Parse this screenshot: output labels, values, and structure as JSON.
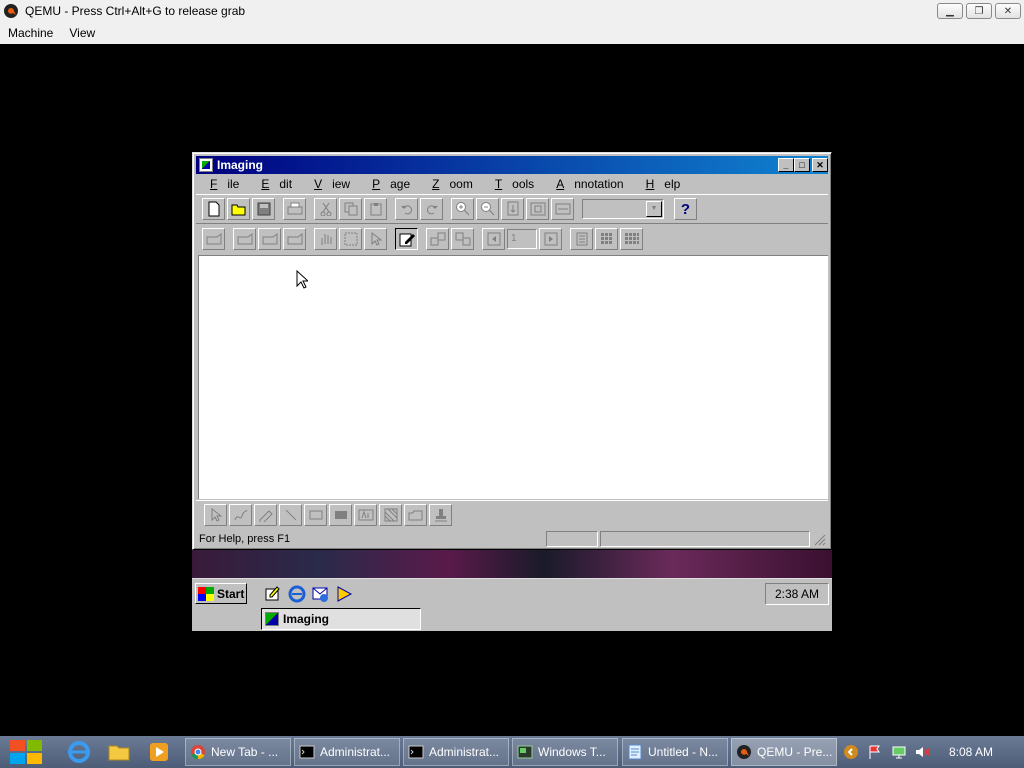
{
  "host": {
    "title": "QEMU - Press Ctrl+Alt+G to release grab",
    "menu": [
      "Machine",
      "View"
    ],
    "controls": {
      "minimize": "▁",
      "restore": "❐",
      "close": "✕"
    }
  },
  "imaging": {
    "title": "Imaging",
    "menu": [
      {
        "label": "File",
        "key": "F",
        "rest": "ile"
      },
      {
        "label": "Edit",
        "key": "E",
        "rest": "dit"
      },
      {
        "label": "View",
        "key": "V",
        "rest": "iew"
      },
      {
        "label": "Page",
        "key": "P",
        "rest": "age"
      },
      {
        "label": "Zoom",
        "key": "Z",
        "rest": "oom"
      },
      {
        "label": "Tools",
        "key": "T",
        "rest": "ools"
      },
      {
        "label": "Annotation",
        "key": "A",
        "rest": "nnotation"
      },
      {
        "label": "Help",
        "key": "H",
        "rest": "elp"
      }
    ],
    "help_button": "?",
    "page_number": "1",
    "status_text": "For Help, press F1",
    "window_buttons": {
      "minimize": "_",
      "maximize": "□",
      "close": "✕"
    }
  },
  "guest_taskbar": {
    "start_label": "Start",
    "clock": "2:38 AM",
    "task_imaging": "Imaging"
  },
  "host_taskbar": {
    "tasks": [
      {
        "label": "New Tab - ...",
        "icon": "chrome-icon"
      },
      {
        "label": "Administrat...",
        "icon": "cmd-icon"
      },
      {
        "label": "Administrat...",
        "icon": "cmd-icon"
      },
      {
        "label": "Windows T...",
        "icon": "terminal-icon"
      },
      {
        "label": "Untitled - N...",
        "icon": "notepad-icon"
      },
      {
        "label": "QEMU - Pre...",
        "icon": "qemu-icon"
      }
    ],
    "clock": "8:08 AM"
  },
  "colors": {
    "win98_face": "#c0c0c0",
    "title_active": "#000080",
    "title_gradient_end": "#1084d0",
    "host_taskbar": "#5a6a86"
  }
}
